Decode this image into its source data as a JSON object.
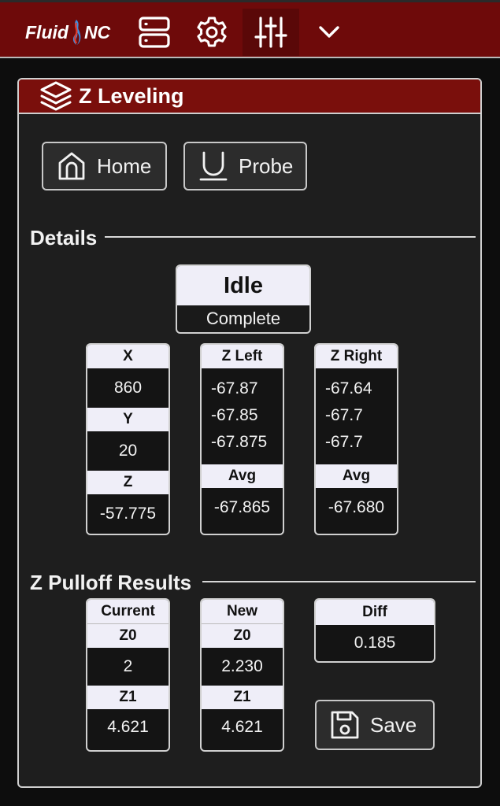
{
  "nav": {
    "logo_left": "Fluid",
    "logo_right": "NC",
    "icons": [
      "server-icon",
      "gear-icon",
      "sliders-icon",
      "chevron-down-icon"
    ]
  },
  "panel": {
    "title": "Z Leveling",
    "icon": "layers-icon",
    "buttons": {
      "home": "Home",
      "probe": "Probe"
    },
    "details": {
      "title": "Details",
      "state": "Idle",
      "status": "Complete",
      "position": {
        "x_label": "X",
        "x": "860",
        "y_label": "Y",
        "y": "20",
        "z_label": "Z",
        "z": "-57.775"
      },
      "z_left": {
        "label": "Z Left",
        "values": [
          "-67.87",
          "-67.85",
          "-67.875"
        ],
        "avg_label": "Avg",
        "avg": "-67.865"
      },
      "z_right": {
        "label": "Z Right",
        "values": [
          "-67.64",
          "-67.7",
          "-67.7"
        ],
        "avg_label": "Avg",
        "avg": "-67.680"
      }
    },
    "pulloff": {
      "title": "Z Pulloff Results",
      "current": {
        "label": "Current",
        "z0_label": "Z0",
        "z0": "2",
        "z1_label": "Z1",
        "z1": "4.621"
      },
      "new": {
        "label": "New",
        "z0_label": "Z0",
        "z0": "2.230",
        "z1_label": "Z1",
        "z1": "4.621"
      },
      "diff": {
        "label": "Diff",
        "value": "0.185"
      },
      "save": "Save"
    }
  },
  "colors": {
    "header": "#6e0a0a",
    "panel_header": "#7a0f0c",
    "label_bg": "#efeef8"
  }
}
